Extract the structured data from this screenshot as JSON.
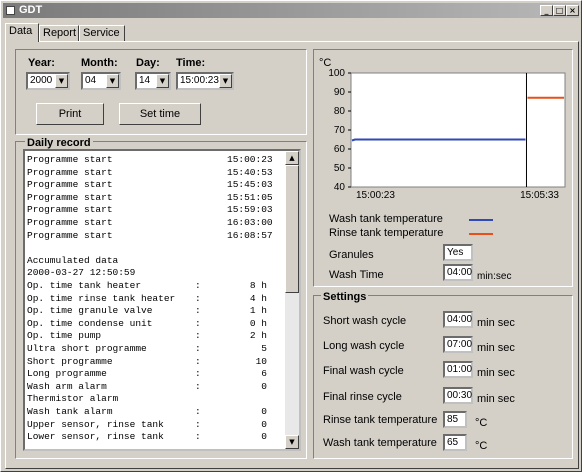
{
  "window": {
    "title": "GDT"
  },
  "tabs": [
    {
      "label": "Data"
    },
    {
      "label": "Report"
    },
    {
      "label": "Service"
    }
  ],
  "date_time": {
    "year_label": "Year:",
    "month_label": "Month:",
    "day_label": "Day:",
    "time_label": "Time:",
    "year": "2000",
    "month": "04",
    "day": "14",
    "time": "15:00:23",
    "print_label": "Print",
    "set_time_label": "Set time"
  },
  "daily_record": {
    "title": "Daily record",
    "rows": [
      {
        "name": "Programme start",
        "sep": "",
        "value": "15:00:23"
      },
      {
        "name": "Programme start",
        "sep": "",
        "value": "15:40:53"
      },
      {
        "name": "Programme start",
        "sep": "",
        "value": "15:45:03"
      },
      {
        "name": "Programme start",
        "sep": "",
        "value": "15:51:05"
      },
      {
        "name": "Programme start",
        "sep": "",
        "value": "15:59:03"
      },
      {
        "name": "Programme start",
        "sep": "",
        "value": "16:03:00"
      },
      {
        "name": "Programme start",
        "sep": "",
        "value": "16:08:57"
      },
      {
        "name": "",
        "sep": "",
        "value": ""
      },
      {
        "name": "Accumulated data",
        "sep": "",
        "value": ""
      },
      {
        "name": "2000-03-27 12:50:59",
        "sep": "",
        "value": ""
      },
      {
        "name": "Op. time tank heater",
        "sep": ":",
        "value": "8 h"
      },
      {
        "name": "Op. time rinse tank heater",
        "sep": ":",
        "value": "4 h"
      },
      {
        "name": "Op. time granule valve",
        "sep": ":",
        "value": "1 h"
      },
      {
        "name": "Op. time condense unit",
        "sep": ":",
        "value": "0 h"
      },
      {
        "name": "Op. time pump",
        "sep": ":",
        "value": "2 h"
      },
      {
        "name": "Ultra short programme",
        "sep": ":",
        "value": "5"
      },
      {
        "name": "Short programme",
        "sep": ":",
        "value": "10"
      },
      {
        "name": "Long programme",
        "sep": ":",
        "value": "6"
      },
      {
        "name": "Wash arm alarm",
        "sep": ":",
        "value": "0"
      },
      {
        "name": "Thermistor alarm",
        "sep": "",
        "value": ""
      },
      {
        "name": "Wash tank alarm",
        "sep": ":",
        "value": "0"
      },
      {
        "name": "Upper sensor, rinse tank",
        "sep": ":",
        "value": "0"
      },
      {
        "name": "Lower sensor, rinse tank",
        "sep": ":",
        "value": "0"
      }
    ]
  },
  "chart_data": {
    "type": "line",
    "ylabel": "°C",
    "ylim": [
      40,
      100
    ],
    "yticks": [
      "100",
      "90",
      "80",
      "70",
      "60",
      "50",
      "40"
    ],
    "xticks": [
      "15:00:23",
      "15:05:33"
    ],
    "series": [
      {
        "name": "Wash tank temperature",
        "color": "#2f4ab8",
        "values": [
          65,
          65
        ]
      },
      {
        "name": "Rinse tank temperature",
        "color": "#e8501a",
        "values": [
          87
        ]
      }
    ]
  },
  "status": {
    "granules_label": "Granules",
    "granules_value": "Yes",
    "wash_time_label": "Wash Time",
    "wash_time_value": "04:00",
    "wash_time_unit": "min:sec"
  },
  "settings": {
    "title": "Settings",
    "items": [
      {
        "label": "Short wash cycle",
        "value": "04:00",
        "unit": "min sec"
      },
      {
        "label": "Long wash cycle",
        "value": "07:00",
        "unit": "min sec"
      },
      {
        "label": "Final wash cycle",
        "value": "01:00",
        "unit": "min sec"
      },
      {
        "label": "Final rinse cycle",
        "value": "00:30",
        "unit": "min sec"
      },
      {
        "label": "Rinse tank temperature",
        "value": "85",
        "unit": "°C"
      },
      {
        "label": "Wash tank temperature",
        "value": "65",
        "unit": "°C"
      }
    ]
  }
}
